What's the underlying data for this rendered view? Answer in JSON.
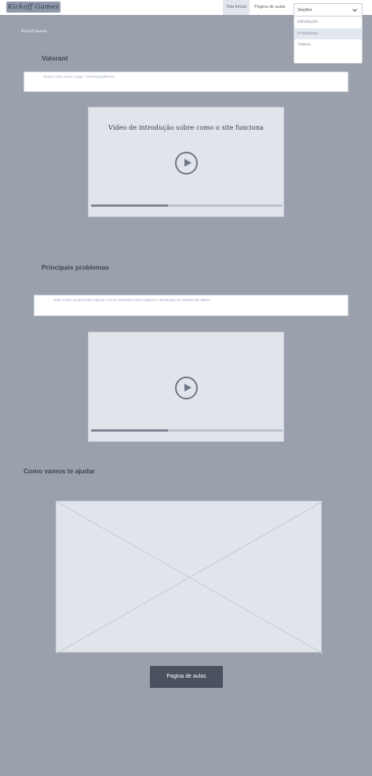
{
  "header": {
    "logo": "Kickoff Games",
    "nav": {
      "home": "Tela Inicial",
      "lessons": "Pagina de aulas"
    },
    "sections_dropdown": {
      "selected": "Seções",
      "options": [
        "Introdução",
        "Problemas",
        "Videos"
      ],
      "highlighted_option": "Problemas"
    }
  },
  "small_logo": "Kickoff Games",
  "intro": {
    "title": "Valorant",
    "text": "Texxto curto sobre o jogo + introdução(breve)",
    "video_title": "Vídeo de introdução sobre como o site funciona",
    "video_progress": 0.4
  },
  "problems": {
    "title": "Principais problemas",
    "text": "Texto sobre os principais topicos e erros cometidos pelos players e introdução ao sistema de videos",
    "video_progress": 0.4
  },
  "help": {
    "title": "Como vamos te ajudar"
  },
  "cta_button": "Pagina de aulas",
  "colors": {
    "background": "#9aa1ac",
    "accent": "#8f98a8",
    "button": "#4a5260",
    "card": "#e1e5eb"
  }
}
